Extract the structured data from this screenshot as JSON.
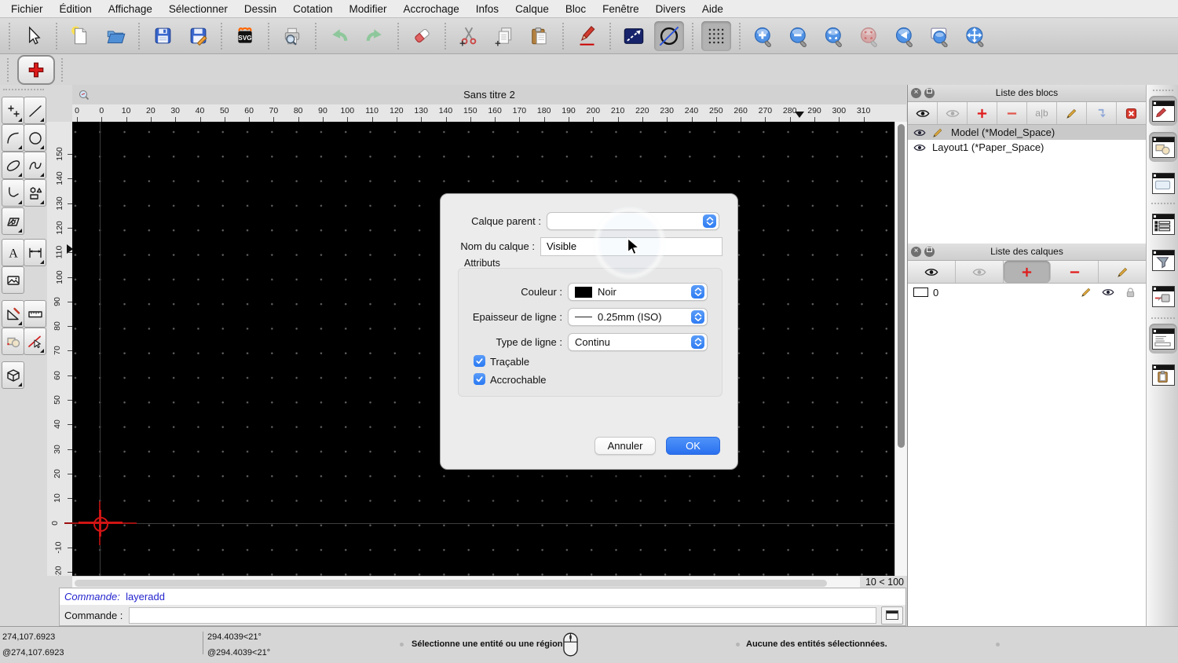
{
  "menu_bar": {
    "items": [
      "Fichier",
      "Édition",
      "Affichage",
      "Sélectionner",
      "Dessin",
      "Cotation",
      "Modifier",
      "Accrochage",
      "Infos",
      "Calque",
      "Bloc",
      "Fenêtre",
      "Divers",
      "Aide"
    ]
  },
  "toolbar": {
    "icon_names": [
      "selection-arrow",
      "new-document",
      "open-file",
      "save",
      "save-as",
      "svg-export",
      "print-preview",
      "undo",
      "redo",
      "delete-eraser",
      "cut",
      "copy",
      "paste",
      "pen-edit",
      "line-attributes",
      "circle-line",
      "grid-toggle",
      "zoom-in",
      "zoom-out",
      "zoom-auto",
      "zoom-selection",
      "zoom-previous",
      "zoom-window",
      "zoom-pan"
    ]
  },
  "action_bar": {
    "current_action": "layer-add"
  },
  "tool_palette": {
    "tool_names": [
      "points",
      "lines",
      "arcs",
      "circles",
      "ellipses",
      "splines",
      "polylines",
      "shapes",
      "hatch",
      "text",
      "dimensions",
      "image",
      "modify",
      "measure",
      "blocks",
      "select",
      "solids"
    ]
  },
  "document": {
    "title": "Sans titre 2",
    "grid_status": "10 < 100"
  },
  "rulers": {
    "h_labels": [
      "0",
      "0",
      "10",
      "20",
      "30",
      "40",
      "50",
      "60",
      "70",
      "80",
      "90",
      "100",
      "110",
      "120",
      "130",
      "140",
      "150",
      "160",
      "170",
      "180",
      "190",
      "200",
      "210",
      "220",
      "230",
      "240",
      "250",
      "260",
      "270",
      "280",
      "290",
      "300",
      "310"
    ],
    "v_labels": [
      "150",
      "140",
      "130",
      "120",
      "110",
      "100",
      "90",
      "80",
      "70",
      "60",
      "50",
      "40",
      "30",
      "20",
      "10",
      "0",
      "-10",
      "-20"
    ]
  },
  "dialog": {
    "parent_label": "Calque parent :",
    "parent_value": "",
    "name_label": "Nom du calque :",
    "name_value": "Visible",
    "group_label": "Attributs",
    "color_label": "Couleur :",
    "color_value": "Noir",
    "width_label": "Epaisseur de ligne :",
    "width_value": "0.25mm (ISO)",
    "linetype_label": "Type de ligne :",
    "linetype_value": "Continu",
    "plottable_label": "Traçable",
    "snappable_label": "Accrochable",
    "cancel_label": "Annuler",
    "ok_label": "OK"
  },
  "blocks_panel": {
    "title": "Liste des blocs",
    "toolbar_icons": [
      "show-all",
      "hide-all",
      "add-block",
      "remove-block",
      "rename-block",
      "edit-block",
      "insert-block",
      "delete-block"
    ],
    "rename_label": "a|b",
    "items": [
      {
        "label": "Model (*Model_Space)",
        "selected": true,
        "icons": [
          "eye",
          "pencil"
        ]
      },
      {
        "label": "Layout1 (*Paper_Space)",
        "selected": false,
        "icons": [
          "eye"
        ]
      }
    ]
  },
  "layers_panel": {
    "title": "Liste des calques",
    "toolbar_icons": [
      "show-all",
      "hide-all",
      "add-layer",
      "remove-layer",
      "edit-layer"
    ],
    "items": [
      {
        "label": "0",
        "icons": [
          "pencil",
          "eye",
          "lock"
        ]
      }
    ]
  },
  "dock": {
    "items": [
      "layer-list",
      "block-list",
      "library-browser",
      "entity-list",
      "selection-filter",
      "plot-preview",
      "command-console",
      "clipboard"
    ]
  },
  "command_console": {
    "history_label": "Commande:",
    "history_value": "layeradd",
    "prompt_label": "Commande :",
    "input_value": ""
  },
  "status_bar": {
    "coord_abs": "274,107.6923",
    "coord_rel": "@274,107.6923",
    "polar_abs": "294.4039<21°",
    "polar_rel": "@294.4039<21°",
    "hint": "Sélectionne une entité ou une région",
    "selection_info": "Aucune des entités sélectionnées."
  },
  "colors": {
    "accent_blue": "#2e7cf3",
    "ok_button": "#2a70ef",
    "canvas": "#000000",
    "crosshair_red": "#d11414",
    "command_text": "#2424cf"
  }
}
